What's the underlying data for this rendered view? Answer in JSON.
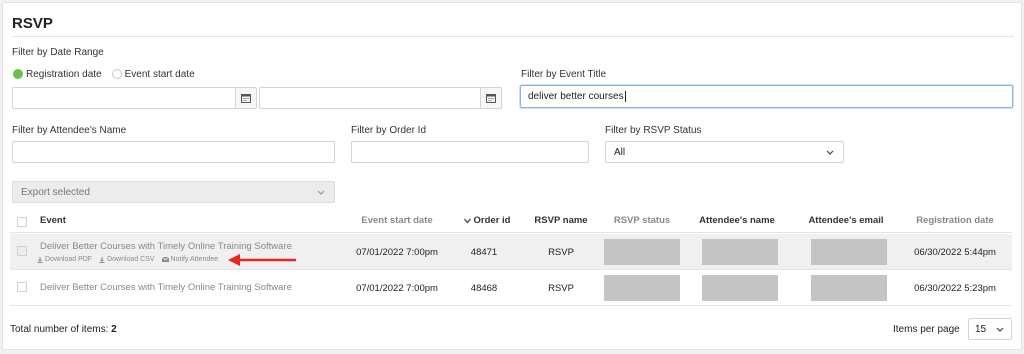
{
  "page": {
    "title": "RSVP"
  },
  "filters": {
    "date_range_label": "Filter by Date Range",
    "radio_registration": "Registration date",
    "radio_event_start": "Event start date",
    "date_from_value": "",
    "date_to_value": "",
    "event_title_label": "Filter by Event Title",
    "event_title_value": "deliver better courses",
    "attendee_name_label": "Filter by Attendee's Name",
    "attendee_name_value": "",
    "order_id_label": "Filter by Order Id",
    "order_id_value": "",
    "rsvp_status_label": "Filter by RSVP Status",
    "rsvp_status_value": "All"
  },
  "bulk": {
    "export_selected": "Export selected"
  },
  "table": {
    "headers": {
      "event": "Event",
      "event_start_date": "Event start date",
      "order_id": "Order id",
      "rsvp_name": "RSVP name",
      "rsvp_status": "RSVP status",
      "attendee_name": "Attendee's name",
      "attendee_email": "Attendee's email",
      "registration_date": "Registration date"
    },
    "rows": [
      {
        "event": "Deliver Better Courses with Timely Online Training Software",
        "event_start_date": "07/01/2022 7:00pm",
        "order_id": "48471",
        "rsvp_name": "RSVP",
        "registration_date": "06/30/2022 5:44pm",
        "actions": {
          "download_pdf": "Download PDF",
          "download_csv": "Download CSV",
          "notify_attendee": "Notify Attendee"
        }
      },
      {
        "event": "Deliver Better Courses with Timely Online Training Software",
        "event_start_date": "07/01/2022 7:00pm",
        "order_id": "48468",
        "rsvp_name": "RSVP",
        "registration_date": "06/30/2022 5:23pm"
      }
    ]
  },
  "footer": {
    "total_label": "Total number of items:",
    "total_count": "2",
    "items_per_page_label": "Items per page",
    "items_per_page_value": "15"
  },
  "colors": {
    "accent_green": "#6cc04a",
    "annotation_red": "#e8261f",
    "redaction_grey": "#c4c4c4"
  }
}
